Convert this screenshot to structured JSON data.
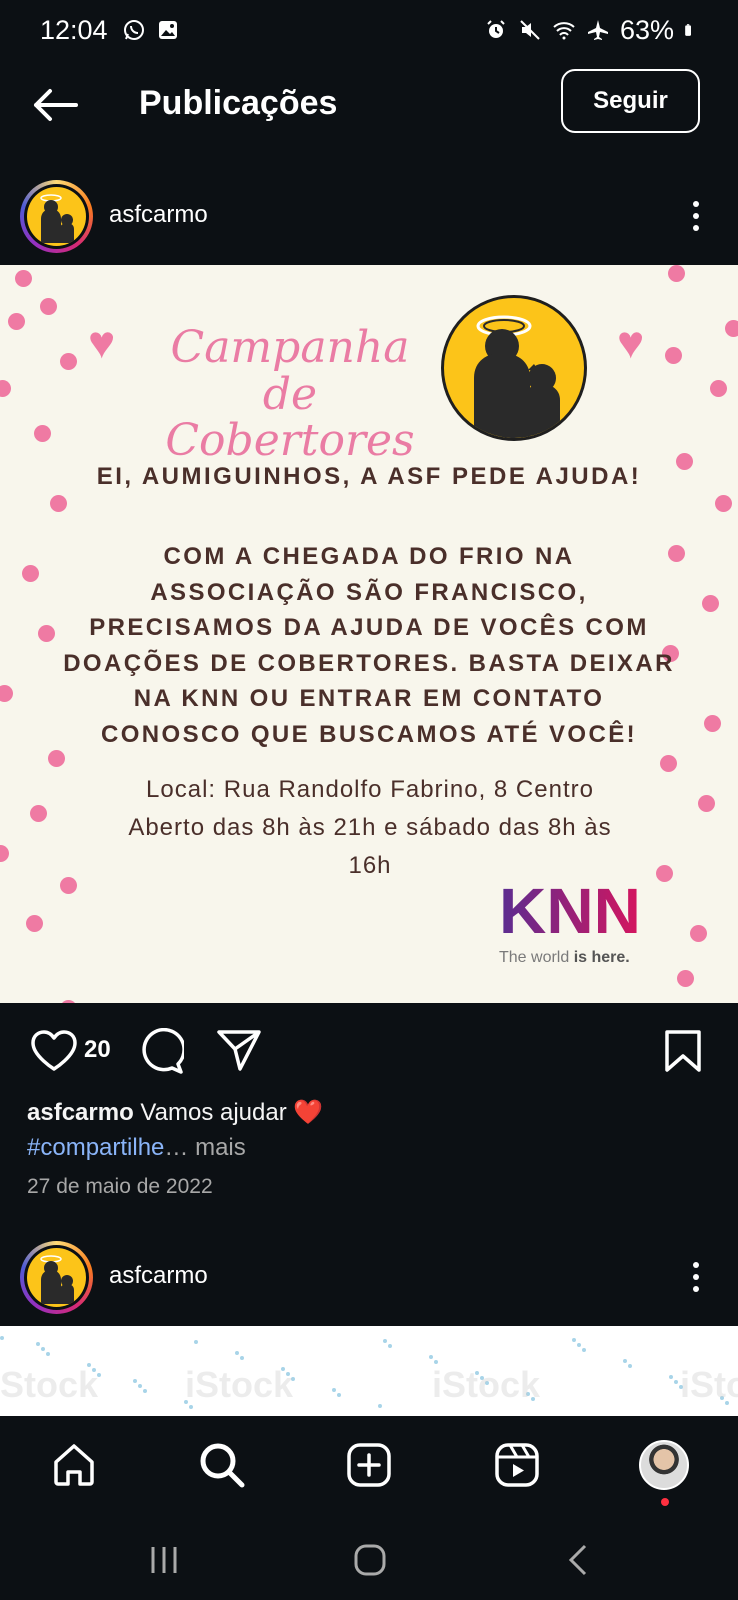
{
  "status_bar": {
    "time": "12:04",
    "battery": "63%",
    "icons_left": [
      "whatsapp-icon",
      "image-icon"
    ],
    "icons_right": [
      "alarm-icon",
      "mute-icon",
      "wifi-icon",
      "airplane-icon",
      "battery-icon"
    ]
  },
  "header": {
    "title": "Publicações",
    "follow_label": "Seguir"
  },
  "post1": {
    "username": "asfcarmo",
    "image": {
      "campaign_title_line1": "Campanha de",
      "campaign_title_line2": "Cobertores",
      "heading": "EI, AUMIGUINHOS, A ASF PEDE AJUDA!",
      "body_lines": [
        "COM A CHEGADA DO FRIO NA",
        "ASSOCIAÇÃO SÃO FRANCISCO,",
        "PRECISAMOS DA AJUDA DE VOCÊS COM",
        "DOAÇÕES DE COBERTORES. BASTA DEIXAR",
        "NA KNN OU ENTRAR EM CONTATO",
        "CONOSCO QUE BUSCAMOS ATÉ VOCÊ!"
      ],
      "info_line1": "Local: Rua Randolfo Fabrino, 8 Centro",
      "info_line2": "Aberto das 8h às 21h e sábado das 8h às",
      "info_line3": "16h",
      "knn_logo_text": "KNN",
      "knn_tagline_pre": "The world ",
      "knn_tagline_bold": "is here."
    },
    "likes": "20",
    "caption_user": "asfcarmo",
    "caption_text": " Vamos ajudar ",
    "caption_emoji": "❤️",
    "hashtag": "#compartilhe",
    "more_label": "… mais",
    "date": "27 de maio de 2022"
  },
  "post2": {
    "username": "asfcarmo",
    "watermark": "iStock"
  },
  "colors": {
    "background": "#0c1014",
    "poster_bg": "#f8f6ec",
    "pink": "#ef7aa3",
    "brown_text": "#4a2f2a",
    "hashtag": "#8ab4f8",
    "logo_yellow": "#fcc419"
  }
}
